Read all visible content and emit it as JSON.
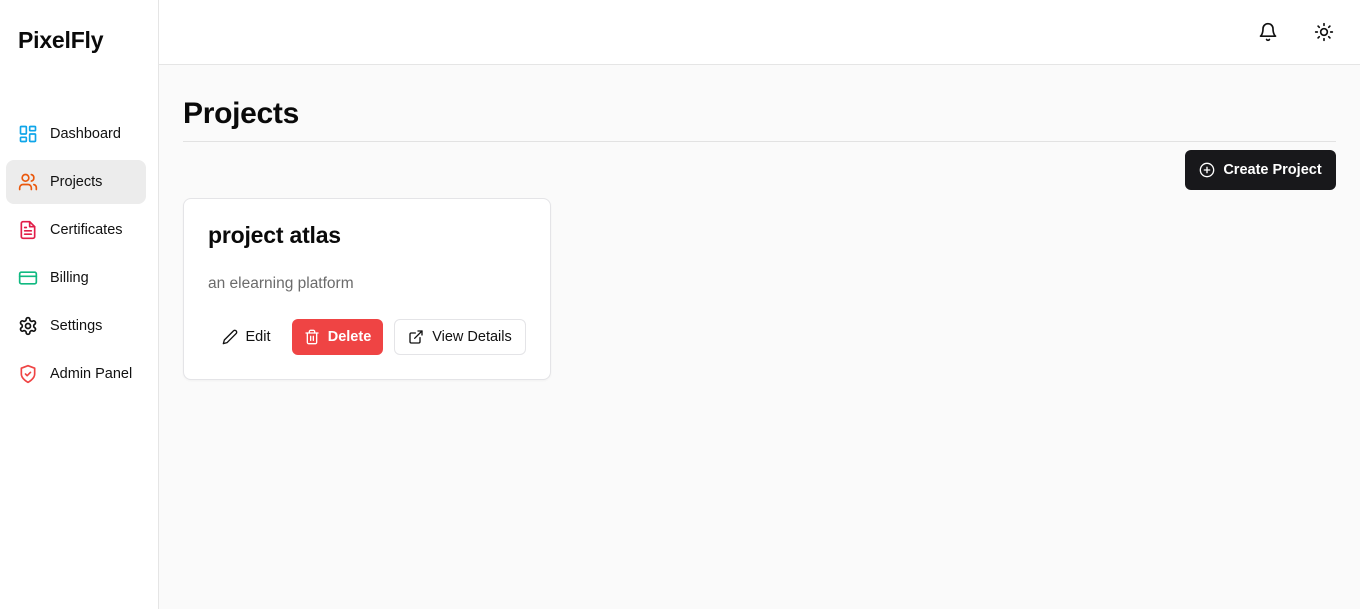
{
  "app": {
    "brand": "PixelFly"
  },
  "sidebar": {
    "items": [
      {
        "label": "Dashboard",
        "icon": "layout-grid-icon",
        "color": "#0ea5e9"
      },
      {
        "label": "Projects",
        "icon": "users-icon",
        "color": "#ea580c",
        "active": true
      },
      {
        "label": "Certificates",
        "icon": "file-text-icon",
        "color": "#e11d48"
      },
      {
        "label": "Billing",
        "icon": "credit-card-icon",
        "color": "#10b981"
      },
      {
        "label": "Settings",
        "icon": "gear-icon",
        "color": "#111111"
      },
      {
        "label": "Admin Panel",
        "icon": "shield-icon",
        "color": "#ef4444"
      }
    ]
  },
  "header": {
    "notifications_icon": "bell-icon",
    "theme_icon": "sun-icon"
  },
  "main": {
    "title": "Projects",
    "create_button": "Create Project",
    "projects": [
      {
        "name": "project atlas",
        "description": "an elearning platform",
        "actions": {
          "edit": "Edit",
          "delete": "Delete",
          "view": "View Details"
        }
      }
    ]
  },
  "colors": {
    "primary_button": "#18181b",
    "danger": "#ef4444",
    "active_nav_bg": "#ececec",
    "main_bg": "#fafafa"
  }
}
